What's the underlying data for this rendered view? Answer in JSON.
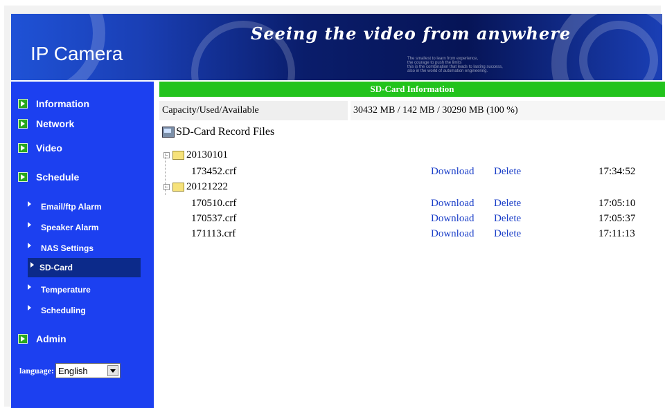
{
  "header": {
    "brand": "IP Camera",
    "slogan": "Seeing the video from anywhere",
    "tagline_lines": [
      "The smallest to learn from experience,",
      "the courage to push the limits",
      "this is the combination that leads to lasting success,",
      "also in the world of automation engineering."
    ]
  },
  "sidebar": {
    "main_items": [
      {
        "label": "Information",
        "icon": "play-arrow-icon"
      },
      {
        "label": "Network",
        "icon": "play-arrow-icon"
      },
      {
        "label": "Video",
        "icon": "play-arrow-icon"
      },
      {
        "label": "Schedule",
        "icon": "play-arrow-icon"
      },
      {
        "label": "Admin",
        "icon": "play-arrow-icon"
      }
    ],
    "sub_items": [
      {
        "label": "Email/ftp Alarm"
      },
      {
        "label": "Speaker Alarm"
      },
      {
        "label": "NAS Settings"
      },
      {
        "label": "SD-Card"
      },
      {
        "label": "Temperature"
      },
      {
        "label": "Scheduling"
      }
    ],
    "active_item": "SD-Card",
    "language": {
      "label": "language:",
      "selected": "English"
    }
  },
  "main": {
    "section_title": "SD-Card Information",
    "capacity_label": "Capacity/Used/Available",
    "capacity_value": "30432 MB / 142 MB / 30290 MB (100 %)",
    "record_title": "SD-Card Record Files",
    "download_label": "Download",
    "delete_label": "Delete",
    "folders": [
      {
        "name": "20130101",
        "files": [
          {
            "name": "173452.crf",
            "time": "17:34:52"
          }
        ]
      },
      {
        "name": "20121222",
        "files": [
          {
            "name": "170510.crf",
            "time": "17:05:10"
          },
          {
            "name": "170537.crf",
            "time": "17:05:37"
          },
          {
            "name": "171113.crf",
            "time": "17:11:13"
          }
        ]
      }
    ]
  },
  "colors": {
    "sidebar_bg": "#1c40f0",
    "active_bg": "#0c2a8a",
    "header_bar": "#22c31c",
    "link": "#1a3ec8"
  }
}
